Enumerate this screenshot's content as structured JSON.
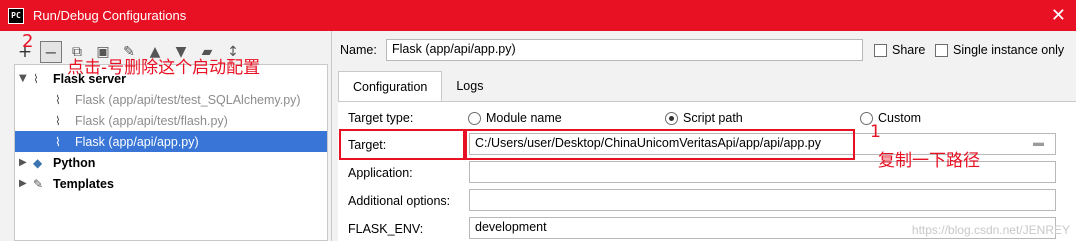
{
  "window": {
    "title": "Run/Debug Configurations",
    "icon_text": "PC"
  },
  "tree": {
    "root": "Flask server",
    "children": [
      "Flask (app/api/test/test_SQLAlchemy.py)",
      "Flask (app/api/test/flash.py)",
      "Flask (app/api/app.py)"
    ],
    "python": "Python",
    "templates": "Templates"
  },
  "annotations": {
    "step2_num": "2",
    "step2_text": "点击-号删除这个启动配置",
    "step1_num": "1",
    "step1_text": "复制一下路径"
  },
  "config": {
    "name_label": "Name:",
    "name_value": "Flask (app/api/app.py)",
    "share_label": "Share",
    "single_instance_label": "Single instance only",
    "tabs": [
      "Configuration",
      "Logs"
    ],
    "target_type_label": "Target type:",
    "target_types": [
      "Module name",
      "Script path",
      "Custom"
    ],
    "target_label": "Target:",
    "target_value": "C:/Users/user/Desktop/ChinaUnicomVeritasApi/app/api/app.py",
    "application_label": "Application:",
    "additional_options_label": "Additional options:",
    "flask_env_label": "FLASK_ENV:",
    "flask_env_value": "development"
  },
  "watermark": "https://blog.csdn.net/JENREY",
  "colors": {
    "titlebar": "#e81123",
    "selection": "#3875d7",
    "annotation": "#e81123"
  }
}
